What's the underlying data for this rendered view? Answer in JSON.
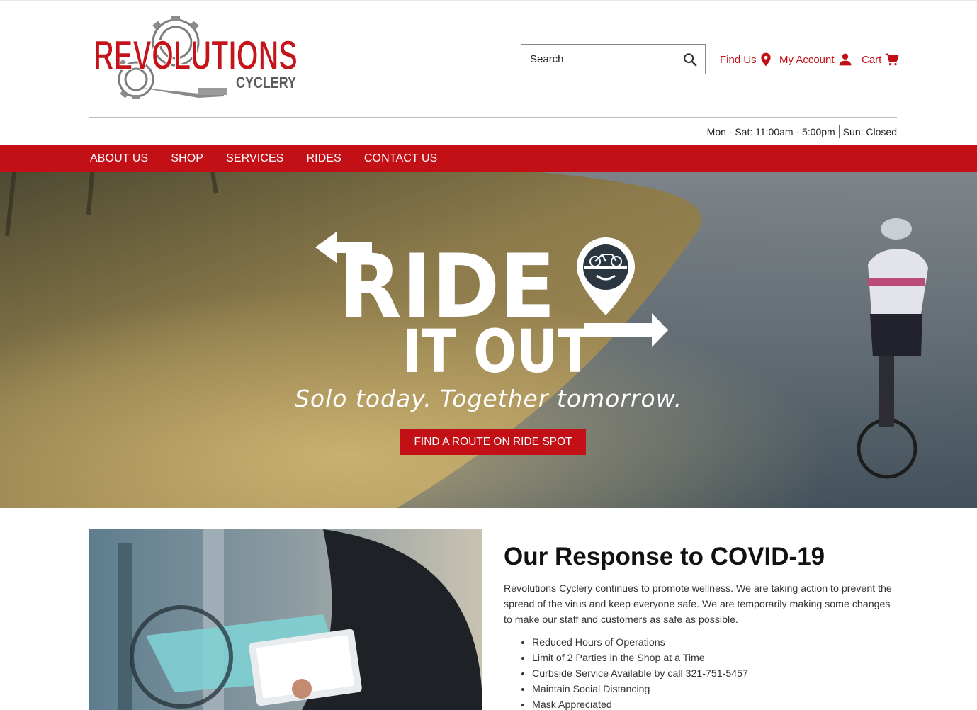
{
  "brand": {
    "logo_word": "REVOLUTIONS",
    "logo_sub": "CYCLERY",
    "primary_color": "#c30f16"
  },
  "header": {
    "search_placeholder": "Search",
    "find_us": "Find Us",
    "my_account": "My Account",
    "cart": "Cart",
    "hours_weekday": "Mon - Sat: 11:00am - 5:00pm",
    "hours_sunday": "Sun: Closed"
  },
  "nav": {
    "items": [
      "ABOUT US",
      "SHOP",
      "SERVICES",
      "RIDES",
      "CONTACT US"
    ]
  },
  "hero": {
    "headline_line1": "RIDE",
    "headline_line2": "IT OUT",
    "tagline": "Solo today. Together tomorrow.",
    "cta": "FIND A ROUTE ON RIDE SPOT"
  },
  "covid": {
    "title": "Our Response to COVID-19",
    "body": "Revolutions Cyclery continues to promote wellness. We are taking action to prevent the spread of the virus and keep everyone safe. We are temporarily making some changes to make our staff and customers as safe as possible.",
    "bullets": [
      "Reduced Hours of Operations",
      "Limit of 2 Parties in the Shop at a Time",
      "Curbside Service Available by call 321-751-5457",
      "Maintain Social Distancing",
      "Mask Appreciated"
    ]
  }
}
